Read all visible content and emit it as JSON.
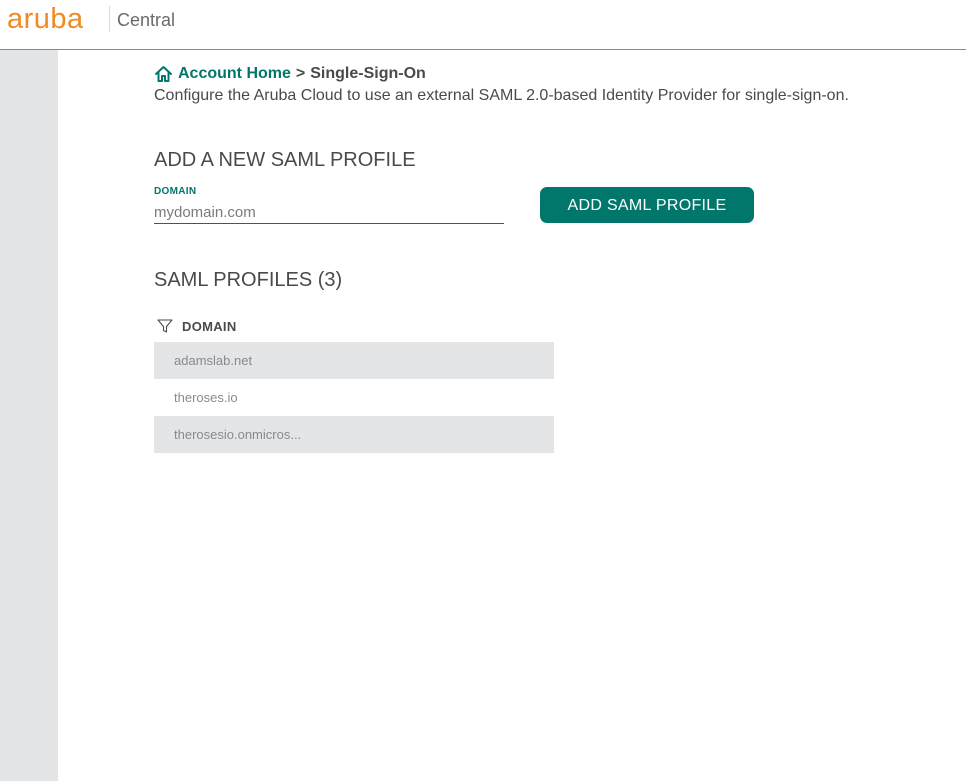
{
  "header": {
    "logo_text": "aruba",
    "product_name": "Central"
  },
  "breadcrumb": {
    "home_label": "Account Home",
    "separator": ">",
    "current": "Single-Sign-On"
  },
  "description": "Configure the Aruba Cloud to use an external SAML 2.0-based Identity Provider for single-sign-on.",
  "add_profile": {
    "title": "ADD A NEW SAML PROFILE",
    "domain_label": "DOMAIN",
    "domain_placeholder": "mydomain.com",
    "domain_value": "",
    "button_label": "ADD SAML PROFILE"
  },
  "profiles": {
    "title": "SAML PROFILES (3)",
    "column_header": "DOMAIN",
    "rows": [
      {
        "domain": "adamslab.net"
      },
      {
        "domain": "theroses.io"
      },
      {
        "domain": "therosesio.onmicros..."
      }
    ]
  },
  "colors": {
    "brand_orange": "#f28a24",
    "accent_teal": "#01776b",
    "sidebar_gray": "#e3e5e6",
    "text": "#4a4a4a"
  },
  "icons": {
    "breadcrumb_home": "home-icon",
    "column_filter": "filter-icon"
  }
}
